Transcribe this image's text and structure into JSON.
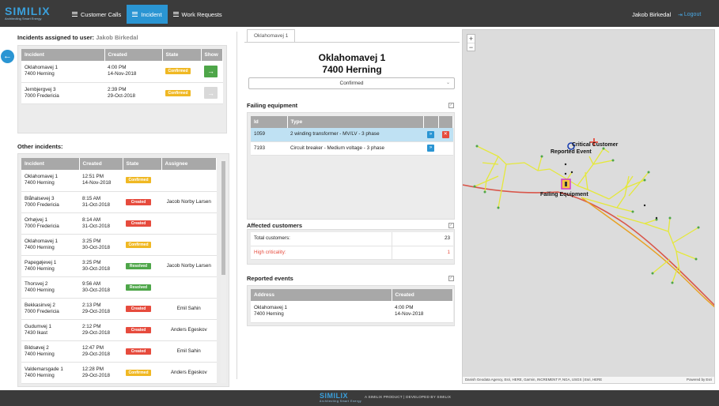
{
  "brand": {
    "name": "SIMILIX",
    "tagline": "Architecting Smart Energy"
  },
  "nav": {
    "items": [
      {
        "label": "Customer Calls",
        "icon": "list-icon",
        "active": false
      },
      {
        "label": "Incident",
        "icon": "list-icon",
        "active": true
      },
      {
        "label": "Work Requests",
        "icon": "list-icon",
        "active": false
      }
    ]
  },
  "user": {
    "name": "Jakob Birkedal",
    "logout_label": "Logout"
  },
  "assigned": {
    "heading": "Incidents assigned to user:",
    "user": "Jakob Birkedal",
    "columns": [
      "Incident",
      "Created",
      "State",
      "Show"
    ],
    "rows": [
      {
        "addr1": "Oklahomavej 1",
        "addr2": "7400 Herning",
        "time": "4:00 PM",
        "date": "14-Nov-2018",
        "state": "Confirmed",
        "show_active": true
      },
      {
        "addr1": "Jernbjergvej 3",
        "addr2": "7000 Fredericia",
        "time": "2:39 PM",
        "date": "29-Oct-2018",
        "state": "Confirmed",
        "show_active": false
      }
    ]
  },
  "other": {
    "heading": "Other incidents:",
    "columns": [
      "Incident",
      "Created",
      "State",
      "Assignee"
    ],
    "rows": [
      {
        "addr1": "Oklahomavej 1",
        "addr2": "7400 Herning",
        "time": "12:51 PM",
        "date": "14-Nov-2018",
        "state": "Confirmed",
        "assignee": ""
      },
      {
        "addr1": "Blåhalsevej 3",
        "addr2": "7000 Fredericia",
        "time": "8:15 AM",
        "date": "31-Oct-2018",
        "state": "Created",
        "assignee": "Jacob Norby Larsen"
      },
      {
        "addr1": "Orhøjvej 1",
        "addr2": "7000 Fredericia",
        "time": "8:14 AM",
        "date": "31-Oct-2018",
        "state": "Created",
        "assignee": ""
      },
      {
        "addr1": "Oklahomavej 1",
        "addr2": "7400 Herning",
        "time": "3:25 PM",
        "date": "30-Oct-2018",
        "state": "Confirmed",
        "assignee": ""
      },
      {
        "addr1": "Papegøjevej 1",
        "addr2": "7400 Herning",
        "time": "3:25 PM",
        "date": "30-Oct-2018",
        "state": "Resolved",
        "assignee": "Jacob Norby Larsen"
      },
      {
        "addr1": "Thorsvej 2",
        "addr2": "7400 Herning",
        "time": "9:56 AM",
        "date": "30-Oct-2018",
        "state": "Resolved",
        "assignee": ""
      },
      {
        "addr1": "Bekkasinvej 2",
        "addr2": "7000 Fredericia",
        "time": "2:13 PM",
        "date": "29-Oct-2018",
        "state": "Created",
        "assignee": "Emil Sahin"
      },
      {
        "addr1": "Gudumvej 1",
        "addr2": "7430 Ikast",
        "time": "2:12 PM",
        "date": "29-Oct-2018",
        "state": "Created",
        "assignee": "Anders Egeskov"
      },
      {
        "addr1": "Bildsøvej 2",
        "addr2": "7400 Herning",
        "time": "12:47 PM",
        "date": "29-Oct-2018",
        "state": "Created",
        "assignee": "Emil Sahin"
      },
      {
        "addr1": "Valdemarsgade 1",
        "addr2": "7400 Herning",
        "time": "12:28 PM",
        "date": "29-Oct-2018",
        "state": "Confirmed",
        "assignee": "Anders Egeskov"
      }
    ]
  },
  "detail": {
    "tab_label": "Oklahomavej 1",
    "title_line1": "Oklahomavej 1",
    "title_line2": "7400 Herning",
    "status_value": "Confirmed",
    "failing": {
      "heading": "Failing equipment",
      "columns": [
        "Id",
        "Type"
      ],
      "rows": [
        {
          "id": "1059",
          "type": "2 winding transformer - MV/LV - 3 phase",
          "selected": true
        },
        {
          "id": "7193",
          "type": "Circuit breaker - Medium voltage - 3 phase",
          "selected": false
        }
      ]
    },
    "affected": {
      "heading": "Affected customers",
      "total_label": "Total customers:",
      "total_value": "23",
      "high_label": "High criticality:",
      "high_value": "1"
    },
    "events": {
      "heading": "Reported events",
      "columns": [
        "Address",
        "Created"
      ],
      "rows": [
        {
          "addr1": "Oklahomavej 1",
          "addr2": "7400 Herning",
          "time": "4:00 PM",
          "date": "14-Nov-2018"
        }
      ]
    }
  },
  "map": {
    "labels": {
      "critical": "Critical Customer",
      "reported": "Reported Event",
      "failing": "Failing Equipment"
    },
    "zoom_in": "+",
    "zoom_out": "−",
    "attribution": "Danish Geodata Agency, Esri, HERE, Garmin, INCREMENT P, NGA, USGS | Esri, HERE",
    "powered": "Powered by Esri"
  },
  "footer": {
    "text": "A SIMILIX PRODUCT | DEVELOPED BY SIMILIX"
  },
  "colors": {
    "accent": "#2a95d3",
    "confirmed": "#f0b823",
    "created": "#e64b3d",
    "resolved": "#4ea649"
  }
}
